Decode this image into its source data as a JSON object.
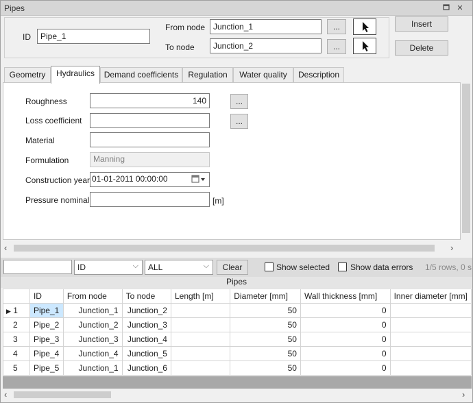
{
  "window": {
    "title": "Pipes"
  },
  "header": {
    "id_label": "ID",
    "id_value": "Pipe_1",
    "from_node_label": "From node",
    "from_node_value": "Junction_1",
    "to_node_label": "To node",
    "to_node_value": "Junction_2",
    "dots_label": "...",
    "insert_label": "Insert",
    "delete_label": "Delete"
  },
  "tabs": [
    {
      "label": "Geometry",
      "active": false
    },
    {
      "label": "Hydraulics",
      "active": true
    },
    {
      "label": "Demand coefficients",
      "active": false
    },
    {
      "label": "Regulation",
      "active": false
    },
    {
      "label": "Water quality",
      "active": false
    },
    {
      "label": "Description",
      "active": false
    }
  ],
  "hydraulics": {
    "roughness_label": "Roughness",
    "roughness_value": "140",
    "loss_label": "Loss coefficient",
    "loss_value": "",
    "material_label": "Material",
    "material_value": "",
    "formulation_label": "Formulation",
    "formulation_value": "Manning",
    "construction_label": "Construction year",
    "construction_value": "01-01-2011 00:00:00",
    "pressure_label": "Pressure nominal",
    "pressure_value": "",
    "pressure_unit": "[m]"
  },
  "toolbar": {
    "search_value": "",
    "field_select": "ID",
    "filter_select": "ALL",
    "clear_label": "Clear",
    "show_selected_label": "Show selected",
    "show_errors_label": "Show data errors",
    "status_text": "1/5 rows, 0 s"
  },
  "grid": {
    "caption": "Pipes",
    "columns": [
      "ID",
      "From node",
      "To node",
      "Length [m]",
      "Diameter [mm]",
      "Wall thickness [mm]",
      "Inner diameter [mm]"
    ],
    "rows": [
      {
        "num": "1",
        "id": "Pipe_1",
        "from": "Junction_1",
        "to": "Junction_2",
        "length": "",
        "diameter": "50",
        "wall": "0",
        "inner": ""
      },
      {
        "num": "2",
        "id": "Pipe_2",
        "from": "Junction_2",
        "to": "Junction_3",
        "length": "",
        "diameter": "50",
        "wall": "0",
        "inner": ""
      },
      {
        "num": "3",
        "id": "Pipe_3",
        "from": "Junction_3",
        "to": "Junction_4",
        "length": "",
        "diameter": "50",
        "wall": "0",
        "inner": ""
      },
      {
        "num": "4",
        "id": "Pipe_4",
        "from": "Junction_4",
        "to": "Junction_5",
        "length": "",
        "diameter": "50",
        "wall": "0",
        "inner": ""
      },
      {
        "num": "5",
        "id": "Pipe_5",
        "from": "Junction_1",
        "to": "Junction_6",
        "length": "",
        "diameter": "50",
        "wall": "0",
        "inner": ""
      }
    ]
  },
  "colors": {
    "selected_cell": "#cce8ff",
    "titlebar": "#d6d6d6"
  }
}
